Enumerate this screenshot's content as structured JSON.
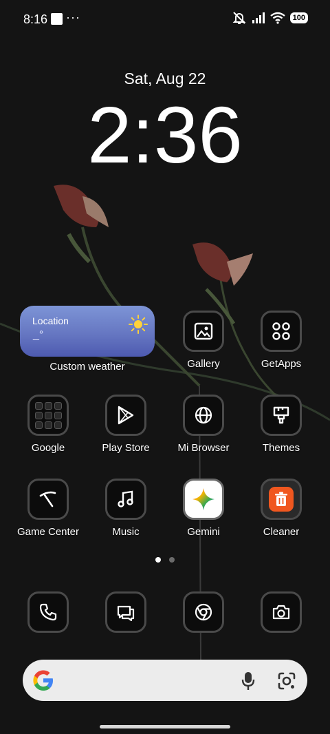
{
  "status_bar": {
    "time": "8:16",
    "more": "···",
    "battery": "100"
  },
  "lockscreen": {
    "date": "Sat, Aug 22",
    "clock": "2:36"
  },
  "weather_widget": {
    "location": "Location",
    "temperature": "_°",
    "label": "Custom weather"
  },
  "apps": {
    "gallery": "Gallery",
    "getapps": "GetApps",
    "google": "Google",
    "play_store": "Play Store",
    "mi_browser": "Mi Browser",
    "themes": "Themes",
    "game_center": "Game Center",
    "music": "Music",
    "gemini": "Gemini",
    "cleaner": "Cleaner"
  },
  "dock": {
    "icons": [
      "phone-icon",
      "messages-icon",
      "chrome-icon",
      "camera-icon"
    ]
  },
  "search_bar": {
    "icons": [
      "google-g-icon",
      "mic-icon",
      "lens-icon"
    ]
  },
  "colors": {
    "background": "#141414",
    "widget_gradient_top": "#7d94d6",
    "cleaner_orange": "#f0571f"
  }
}
